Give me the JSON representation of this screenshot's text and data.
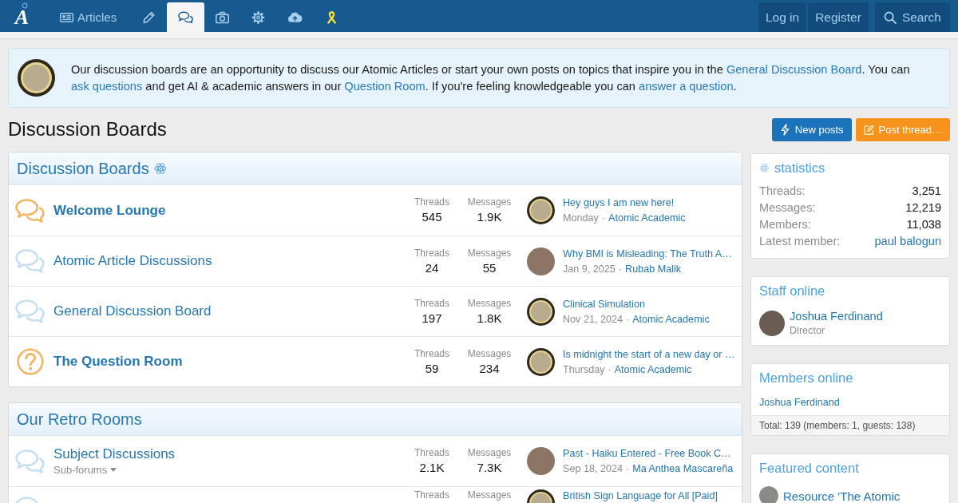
{
  "logo": {
    "text": "A"
  },
  "nav": {
    "tabs": [
      {
        "label": "Articles",
        "selected": false
      },
      {
        "selected": false
      },
      {
        "selected": true
      },
      {
        "selected": false
      },
      {
        "selected": false
      },
      {
        "selected": false
      },
      {
        "selected": false
      }
    ],
    "account": [
      {
        "label": "Log in"
      },
      {
        "label": "Register"
      }
    ],
    "search": {
      "label": "Search"
    }
  },
  "notice": {
    "segments": [
      {
        "kind": "text",
        "text": "Our discussion boards are an opportunity to discuss our Atomic Articles or start your own posts on topics that inspire you in the "
      },
      {
        "kind": "link",
        "text": "General Discussion Board"
      },
      {
        "kind": "text",
        "text": ". You can "
      },
      {
        "kind": "link",
        "text": "ask questions"
      },
      {
        "kind": "text",
        "text": " and get AI & academic answers in our "
      },
      {
        "kind": "link",
        "text": "Question Room"
      },
      {
        "kind": "text",
        "text": ". If you're feeling knowledgeable you can "
      },
      {
        "kind": "link",
        "text": "answer a question"
      },
      {
        "kind": "text",
        "text": "."
      }
    ]
  },
  "page_title": "Discussion Boards",
  "actions": [
    {
      "kind": "new_posts",
      "label": "New posts"
    },
    {
      "kind": "post_thread",
      "label": "Post thread…"
    }
  ],
  "categories": [
    {
      "title": "Discussion Boards",
      "emblem": true,
      "forums": [
        {
          "kind": "discussion",
          "unread": true,
          "title": "Welcome Lounge",
          "stats": [
            {
              "label": "Threads",
              "value": "545"
            },
            {
              "label": "Messages",
              "value": "1.9K"
            }
          ],
          "last_post": {
            "title": "Hey guys I am new here!",
            "date": "Monday",
            "separator": "·",
            "author": "Atomic Academic",
            "avatar": {
              "kind": "logo"
            }
          }
        },
        {
          "kind": "discussion",
          "unread": false,
          "title": "Atomic Article Discussions",
          "stats": [
            {
              "label": "Threads",
              "value": "24"
            },
            {
              "label": "Messages",
              "value": "55"
            }
          ],
          "last_post": {
            "title": "Why BMI is Misleading: The Truth A…",
            "date": "Jan 9, 2025",
            "separator": "·",
            "author": "Rubab Malik",
            "avatar": {
              "kind": "photo"
            }
          }
        },
        {
          "kind": "discussion",
          "unread": false,
          "title": "General Discussion Board",
          "stats": [
            {
              "label": "Threads",
              "value": "197"
            },
            {
              "label": "Messages",
              "value": "1.8K"
            }
          ],
          "last_post": {
            "title": "Clinical Simulation",
            "date": "Nov 21, 2024",
            "separator": "·",
            "author": "Atomic Academic",
            "avatar": {
              "kind": "logo"
            }
          }
        },
        {
          "kind": "question",
          "unread": true,
          "title": "The Question Room",
          "stats": [
            {
              "label": "Threads",
              "value": "59"
            },
            {
              "label": "Messages",
              "value": "234"
            }
          ],
          "last_post": {
            "title": "Is midnight the start of a new day or …",
            "date": "Thursday",
            "separator": "·",
            "author": "Atomic Academic",
            "avatar": {
              "kind": "logo"
            }
          }
        }
      ]
    },
    {
      "title": "Our Retro Rooms",
      "emblem": false,
      "forums": [
        {
          "kind": "discussion",
          "unread": false,
          "title": "Subject Discussions",
          "subforums": {
            "label": "Sub-forums"
          },
          "stats": [
            {
              "label": "Threads",
              "value": "2.1K"
            },
            {
              "label": "Messages",
              "value": "7.3K"
            }
          ],
          "last_post": {
            "title": "Past - Haiku Entered - Free Book C…",
            "date": "Sep 18, 2024",
            "separator": "·",
            "author": "Ma Anthea Mascareña",
            "avatar": {
              "kind": "photo"
            }
          }
        },
        {
          "kind": "discussion",
          "unread": false,
          "stats": [
            {
              "label": "Threads"
            },
            {
              "label": "Messages"
            }
          ],
          "last_post": {
            "title": "British Sign Language for All [Paid]",
            "avatar": {
              "kind": "logo"
            }
          }
        }
      ]
    }
  ],
  "sidebar": [
    {
      "kind": "stats",
      "title": "statistics",
      "rows": [
        {
          "label": "Threads:",
          "value": "3,251",
          "link": false
        },
        {
          "label": "Messages:",
          "value": "12,219",
          "link": false
        },
        {
          "label": "Members:",
          "value": "11,038",
          "link": false
        },
        {
          "label": "Latest member:",
          "value": "paul balogun",
          "link": true
        }
      ]
    },
    {
      "kind": "staff",
      "title": "Staff online",
      "members": [
        {
          "name": "Joshua Ferdinand",
          "role": "Director"
        }
      ]
    },
    {
      "kind": "online",
      "title": "Members online",
      "members": [
        "Joshua Ferdinand"
      ],
      "footer": "Total: 139 (members: 1, guests: 138)"
    },
    {
      "kind": "featured",
      "title": "Featured content",
      "items": [
        {
          "title": "Resource 'The Atomic"
        }
      ]
    }
  ]
}
